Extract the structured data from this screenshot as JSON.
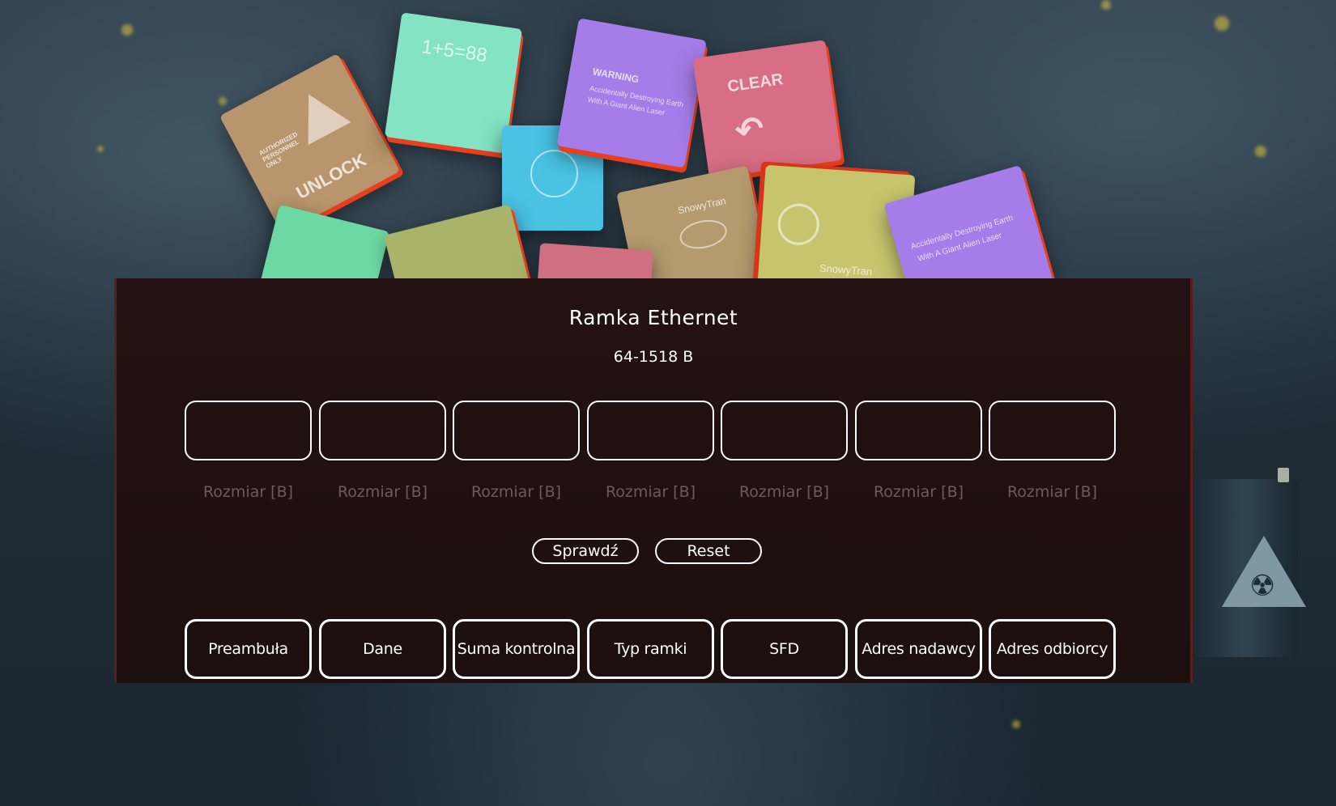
{
  "notes": {
    "unlock": {
      "top": "AUTHORIZED PERSONNEL ONLY",
      "main": "UNLOCK"
    },
    "math": "1+5=88",
    "warning": {
      "title": "WARNING",
      "line1": "Accidentally Destroying Earth",
      "line2": "With A Giant Alien Laser"
    },
    "clear": "CLEAR",
    "snowy1": "SnowyTran",
    "snowy2": "SnowyTran",
    "laser": {
      "line1": "Accidentally Destroying Earth",
      "line2": "With A Giant Alien Laser"
    }
  },
  "panel": {
    "title": "Ramka Ethernet",
    "subtitle": "64-1518 B",
    "size_labels": [
      "Rozmiar [B]",
      "Rozmiar [B]",
      "Rozmiar [B]",
      "Rozmiar [B]",
      "Rozmiar [B]",
      "Rozmiar [B]",
      "Rozmiar [B]"
    ],
    "check_label": "Sprawdź",
    "reset_label": "Reset",
    "tiles": [
      "Preambuła",
      "Dane",
      "Suma kontrolna",
      "Typ ramki",
      "SFD",
      "Adres nadawcy",
      "Adres odbiorcy"
    ]
  },
  "colors": {
    "panel_bg": "#1f100f",
    "panel_border": "#5a1e1e",
    "label_muted": "#6e5b58",
    "note_edge": "#e8401e"
  },
  "icons": [
    "radiation-icon"
  ]
}
